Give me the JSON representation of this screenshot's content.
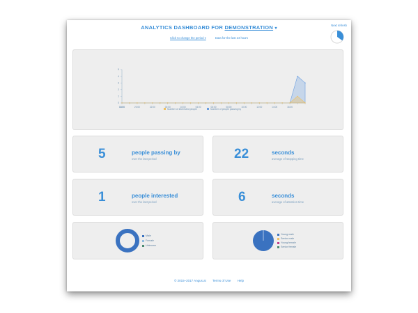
{
  "header": {
    "title_prefix": "ANALYTICS DASHBOARD FOR",
    "title_project": "DEMONSTRATION",
    "title_caret": "▾",
    "period_link": "Click to change the period ▾",
    "period_info": "Data for the last 24 hours",
    "refresh_label": "Next refresh",
    "refresh_progress": 0.35
  },
  "colors": {
    "accent": "#3a8fd8",
    "series_interested": "#f0c060",
    "series_passing": "#6a9ee0",
    "male": "#3a72c0",
    "female": "#8fbce0",
    "unknown": "#4a8a70",
    "young_male": "#3a72c0",
    "senior_male": "#f0c060",
    "young_female": "#c03a8a",
    "senior_female": "#4a8a70"
  },
  "chart_data": {
    "type": "area",
    "x": [
      "18:00",
      "19:00",
      "20:00",
      "21:00",
      "22:00",
      "23:00",
      "00:00",
      "01:00",
      "02:00",
      "03:00",
      "04:00",
      "05:00",
      "06:00",
      "07:00",
      "08:00",
      "09:00",
      "10:00",
      "11:00",
      "12:00",
      "13:00",
      "14:00",
      "15:00",
      "16:00",
      "17:00",
      "18:00"
    ],
    "x_ticks": [
      "18:00",
      "20:00",
      "22:00",
      "00:00",
      "02:00",
      "04:00",
      "06:00",
      "08:00",
      "10:00",
      "12:00",
      "14:00",
      "16:00",
      "18:00"
    ],
    "ylim": [
      0,
      5
    ],
    "y_ticks": [
      0,
      1,
      2,
      3,
      4,
      5
    ],
    "series": [
      {
        "name": "Number of interested people",
        "values": [
          0,
          0,
          0,
          0,
          0,
          0,
          0,
          0,
          0,
          0,
          0,
          0,
          0,
          0,
          0,
          0,
          0,
          0,
          0,
          0,
          0,
          0,
          0,
          1,
          0
        ]
      },
      {
        "name": "Number of people passing by",
        "values": [
          0,
          0,
          0,
          0,
          0,
          0,
          0,
          0,
          0,
          0,
          0,
          0,
          0,
          0,
          0,
          0,
          0,
          0,
          0,
          0,
          0,
          0,
          0,
          4,
          3
        ]
      }
    ],
    "legend": "bottom",
    "grid": false
  },
  "stats": [
    {
      "value": "5",
      "label": "people passing by",
      "sub": "over the last period"
    },
    {
      "value": "22",
      "label": "seconds",
      "sub": "average of stopping time"
    },
    {
      "value": "1",
      "label": "people interested",
      "sub": "over the last period"
    },
    {
      "value": "6",
      "label": "seconds",
      "sub": "average of attention time"
    }
  ],
  "gender_pie": {
    "legend": [
      "Male",
      "Female",
      "Unknown"
    ],
    "values": [
      1,
      0,
      0
    ]
  },
  "age_pie": {
    "legend": [
      "Young male",
      "Senior male",
      "Young female",
      "Senior female"
    ],
    "values": [
      1,
      0,
      0,
      0
    ]
  },
  "footer": {
    "copyright": "© 2015–2017 Angus.ai",
    "terms": "Terms of Use",
    "help": "Help"
  }
}
